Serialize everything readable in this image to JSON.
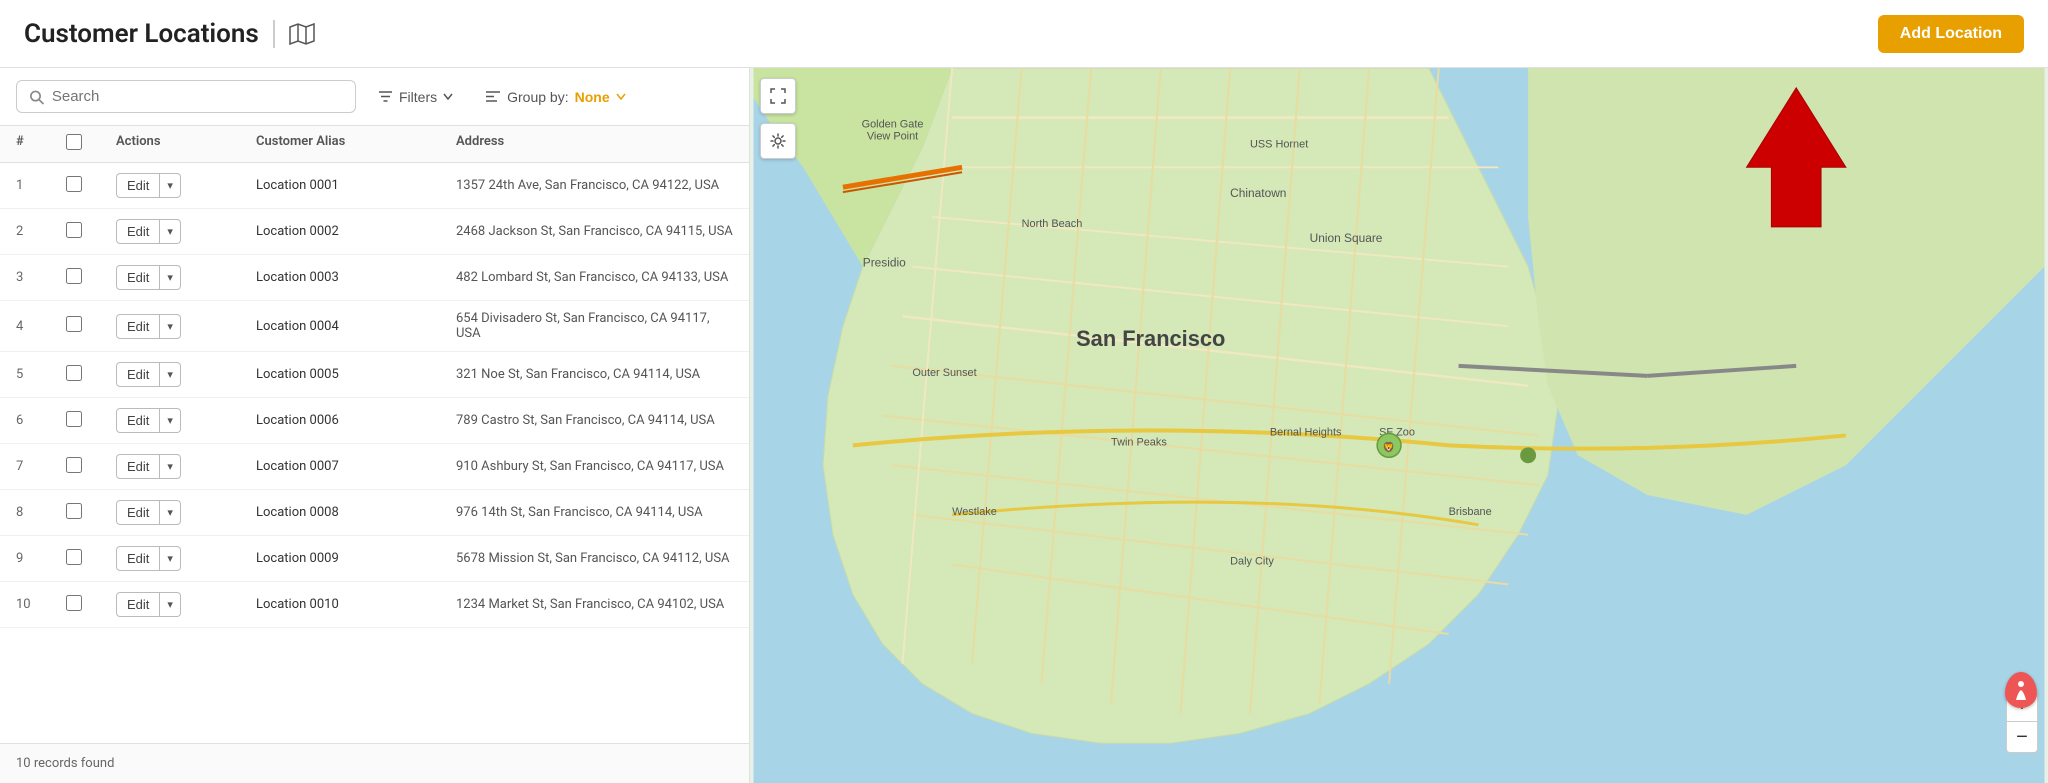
{
  "header": {
    "title": "Customer Locations",
    "add_button_label": "Add Location",
    "map_icon": "map-icon"
  },
  "toolbar": {
    "search_placeholder": "Search",
    "filter_label": "Filters",
    "groupby_label": "Group by:",
    "groupby_value": "None"
  },
  "table": {
    "columns": {
      "num": "#",
      "actions": "Actions",
      "alias": "Customer Alias",
      "address": "Address"
    },
    "rows": [
      {
        "num": 1,
        "alias": "Location 0001",
        "address": "1357 24th Ave, San Francisco, CA 94122, USA"
      },
      {
        "num": 2,
        "alias": "Location 0002",
        "address": "2468 Jackson St, San Francisco, CA 94115, USA"
      },
      {
        "num": 3,
        "alias": "Location 0003",
        "address": "482 Lombard St, San Francisco, CA 94133, USA"
      },
      {
        "num": 4,
        "alias": "Location 0004",
        "address": "654 Divisadero St, San Francisco, CA 94117, USA"
      },
      {
        "num": 5,
        "alias": "Location 0005",
        "address": "321 Noe St, San Francisco, CA 94114, USA"
      },
      {
        "num": 6,
        "alias": "Location 0006",
        "address": "789 Castro St, San Francisco, CA 94114, USA"
      },
      {
        "num": 7,
        "alias": "Location 0007",
        "address": "910 Ashbury St, San Francisco, CA 94117, USA"
      },
      {
        "num": 8,
        "alias": "Location 0008",
        "address": "976 14th St, San Francisco, CA 94114, USA"
      },
      {
        "num": 9,
        "alias": "Location 0009",
        "address": "5678 Mission St, San Francisco, CA 94112, USA"
      },
      {
        "num": 10,
        "alias": "Location 0010",
        "address": "1234 Market St, San Francisco, CA 94102, USA"
      }
    ],
    "edit_label": "Edit",
    "records_text": "10 records found"
  },
  "map": {
    "zoom_in": "+",
    "zoom_out": "−"
  }
}
